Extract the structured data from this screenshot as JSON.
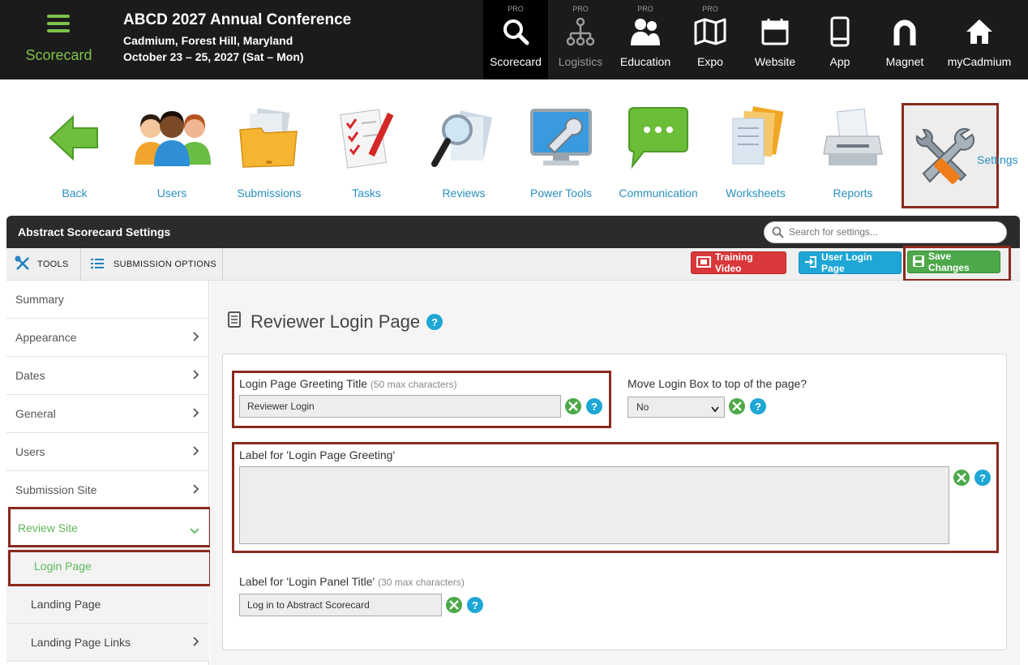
{
  "brand": {
    "name": "Scorecard"
  },
  "conference": {
    "title": "ABCD 2027 Annual Conference",
    "location": "Cadmium, Forest Hill, Maryland",
    "dates": "October 23 – 25, 2027 (Sat – Mon)"
  },
  "modules": [
    {
      "pro": "PRO",
      "label": "Scorecard",
      "icon": "search-icon"
    },
    {
      "pro": "PRO",
      "label": "Logistics",
      "icon": "org-chart-icon"
    },
    {
      "pro": "PRO",
      "label": "Education",
      "icon": "people-icon"
    },
    {
      "pro": "PRO",
      "label": "Expo",
      "icon": "map-icon"
    },
    {
      "pro": "",
      "label": "Website",
      "icon": "calendar-icon"
    },
    {
      "pro": "",
      "label": "App",
      "icon": "phone-icon"
    },
    {
      "pro": "",
      "label": "Magnet",
      "icon": "magnet-icon"
    },
    {
      "pro": "",
      "label": "myCadmium",
      "icon": "home-icon"
    }
  ],
  "nav": [
    {
      "label": "Back",
      "icon": "back-arrow-icon"
    },
    {
      "label": "Users",
      "icon": "users-icon"
    },
    {
      "label": "Submissions",
      "icon": "folder-icon"
    },
    {
      "label": "Tasks",
      "icon": "checklist-icon"
    },
    {
      "label": "Reviews",
      "icon": "magnifier-icon"
    },
    {
      "label": "Power Tools",
      "icon": "monitor-wrench-icon"
    },
    {
      "label": "Communication",
      "icon": "chat-bubble-icon"
    },
    {
      "label": "Worksheets",
      "icon": "documents-icon"
    },
    {
      "label": "Reports",
      "icon": "printer-icon"
    },
    {
      "label": "Settings",
      "icon": "tools-icon"
    }
  ],
  "panel": {
    "title": "Abstract Scorecard Settings",
    "search_placeholder": "Search for settings..."
  },
  "toolbar": {
    "tools": "TOOLS",
    "submission_options": "SUBMISSION OPTIONS",
    "training_video": "Training Video",
    "user_login_page": "User Login Page",
    "save_changes": "Save Changes"
  },
  "sidebar": {
    "items": [
      {
        "label": "Summary"
      },
      {
        "label": "Appearance"
      },
      {
        "label": "Dates"
      },
      {
        "label": "General"
      },
      {
        "label": "Users"
      },
      {
        "label": "Submission Site"
      },
      {
        "label": "Review Site"
      },
      {
        "label": "Login Page"
      },
      {
        "label": "Landing Page"
      },
      {
        "label": "Landing Page Links"
      }
    ]
  },
  "page": {
    "title": "Reviewer Login Page"
  },
  "form": {
    "greeting_title_label": "Login Page Greeting Title",
    "greeting_title_hint": "(50 max characters)",
    "greeting_title_value": "Reviewer Login",
    "move_box_label": "Move Login Box to top of the page?",
    "move_box_value": "No",
    "greeting_label": "Label for 'Login Page Greeting'",
    "panel_title_label": "Label for 'Login Panel Title'",
    "panel_title_hint": "(30 max characters)",
    "panel_title_value": "Log in to Abstract Scorecard"
  },
  "colors": {
    "accent_green": "#7fc24a",
    "link_blue": "#2a8fc0",
    "highlight": "#8a2a1e",
    "training_red": "#d9383a",
    "login_cyan": "#1ea7d6",
    "save_green": "#4da84a"
  }
}
